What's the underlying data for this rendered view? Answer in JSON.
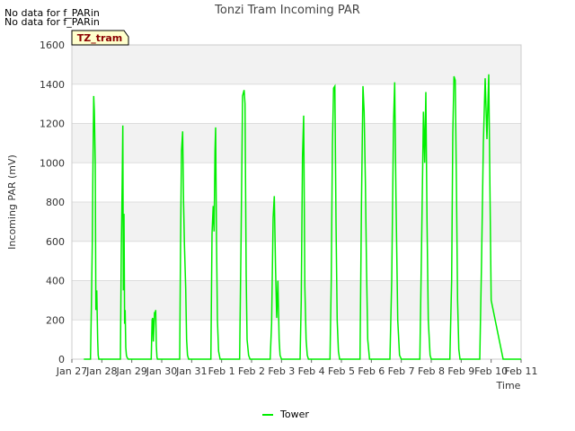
{
  "notices": [
    "No data for f_PARin",
    "No data for f_PARin"
  ],
  "badge": "TZ_tram",
  "colors": {
    "series": "#00ee00",
    "band": "#f2f2f2",
    "grid": "#dddddd",
    "badge_bg": "#ffffcc"
  },
  "chart_data": {
    "type": "line",
    "title": "Tonzi Tram Incoming PAR",
    "xlabel": "Time",
    "ylabel": "Incoming PAR (mV)",
    "xlim": [
      0,
      15
    ],
    "ylim": [
      0,
      1600
    ],
    "x_tick_labels": [
      "Jan 27",
      "Jan 28",
      "Jan 29",
      "Jan 30",
      "Jan 31",
      "Feb 1",
      "Feb 2",
      "Feb 3",
      "Feb 4",
      "Feb 5",
      "Feb 6",
      "Feb 7",
      "Feb 8",
      "Feb 9",
      "Feb 10",
      "Feb 11"
    ],
    "y_ticks": [
      0,
      200,
      400,
      600,
      800,
      1000,
      1200,
      1400,
      1600
    ],
    "grid": true,
    "legend": "bottom-center",
    "series": [
      {
        "name": "Tower",
        "x_unit": "days since Jan 27",
        "x": [
          0.4,
          0.62,
          0.65,
          0.68,
          0.7,
          0.73,
          0.75,
          0.78,
          0.8,
          0.83,
          0.86,
          0.88,
          0.9,
          0.95,
          1.0,
          1.4,
          1.62,
          1.65,
          1.68,
          1.7,
          1.72,
          1.74,
          1.76,
          1.78,
          1.8,
          1.82,
          1.84,
          1.86,
          1.88,
          1.92,
          2.0,
          2.4,
          2.65,
          2.68,
          2.7,
          2.72,
          2.74,
          2.76,
          2.78,
          2.8,
          2.82,
          2.84,
          2.86,
          2.9,
          3.0,
          3.4,
          3.6,
          3.63,
          3.66,
          3.7,
          3.73,
          3.76,
          3.8,
          3.83,
          3.86,
          3.9,
          3.95,
          4.0,
          4.4,
          4.64,
          4.68,
          4.72,
          4.75,
          4.78,
          4.8,
          4.83,
          4.86,
          4.9,
          4.95,
          5.0,
          5.4,
          5.6,
          5.65,
          5.7,
          5.75,
          5.78,
          5.82,
          5.85,
          5.9,
          5.95,
          6.0,
          6.4,
          6.62,
          6.67,
          6.72,
          6.76,
          6.8,
          6.84,
          6.88,
          6.92,
          6.95,
          7.0,
          7.4,
          7.62,
          7.66,
          7.7,
          7.74,
          7.78,
          7.82,
          7.86,
          7.9,
          7.94,
          8.0,
          8.4,
          8.62,
          8.66,
          8.7,
          8.74,
          8.78,
          8.82,
          8.86,
          8.9,
          8.94,
          9.0,
          9.4,
          9.62,
          9.67,
          9.72,
          9.76,
          9.8,
          9.84,
          9.88,
          9.94,
          10.0,
          10.4,
          10.62,
          10.68,
          10.74,
          10.78,
          10.82,
          10.88,
          10.94,
          11.0,
          11.4,
          11.62,
          11.68,
          11.74,
          11.78,
          11.82,
          11.86,
          11.9,
          11.96,
          12.0,
          12.4,
          12.62,
          12.68,
          12.72,
          12.76,
          12.8,
          12.84,
          12.88,
          12.92,
          12.96,
          13.0,
          13.4,
          13.62,
          13.68,
          13.74,
          13.8,
          13.86,
          13.92,
          13.96,
          14.0,
          14.4,
          14.62,
          14.66,
          14.7,
          14.74,
          14.78,
          14.82,
          14.86,
          14.9,
          14.96,
          15.0
        ],
        "values": [
          0,
          0,
          260,
          580,
          900,
          1340,
          1260,
          1000,
          250,
          350,
          100,
          20,
          0,
          0,
          0,
          0,
          0,
          550,
          900,
          1190,
          350,
          740,
          180,
          250,
          60,
          20,
          10,
          5,
          0,
          0,
          0,
          0,
          0,
          200,
          210,
          90,
          160,
          240,
          230,
          250,
          70,
          10,
          0,
          0,
          0,
          0,
          0,
          600,
          1060,
          1160,
          800,
          580,
          360,
          100,
          20,
          0,
          0,
          0,
          0,
          0,
          640,
          780,
          650,
          1060,
          1180,
          600,
          200,
          40,
          0,
          0,
          0,
          0,
          600,
          1340,
          1370,
          1300,
          430,
          100,
          20,
          0,
          0,
          0,
          0,
          180,
          720,
          830,
          460,
          210,
          400,
          100,
          20,
          0,
          0,
          0,
          300,
          1030,
          1240,
          370,
          100,
          20,
          0,
          0,
          0,
          0,
          0,
          400,
          1090,
          1380,
          1390,
          700,
          200,
          40,
          0,
          0,
          0,
          0,
          780,
          1390,
          1260,
          900,
          450,
          100,
          0,
          0,
          0,
          0,
          400,
          1200,
          1410,
          830,
          200,
          20,
          0,
          0,
          0,
          600,
          1260,
          1000,
          1360,
          700,
          200,
          20,
          0,
          0,
          0,
          400,
          1150,
          1440,
          1420,
          900,
          300,
          50,
          0,
          0,
          0,
          0,
          500,
          1100,
          1430,
          1120,
          1450,
          880,
          300,
          0,
          0,
          0,
          0,
          0,
          0,
          0,
          0,
          0,
          0,
          0
        ]
      }
    ]
  }
}
